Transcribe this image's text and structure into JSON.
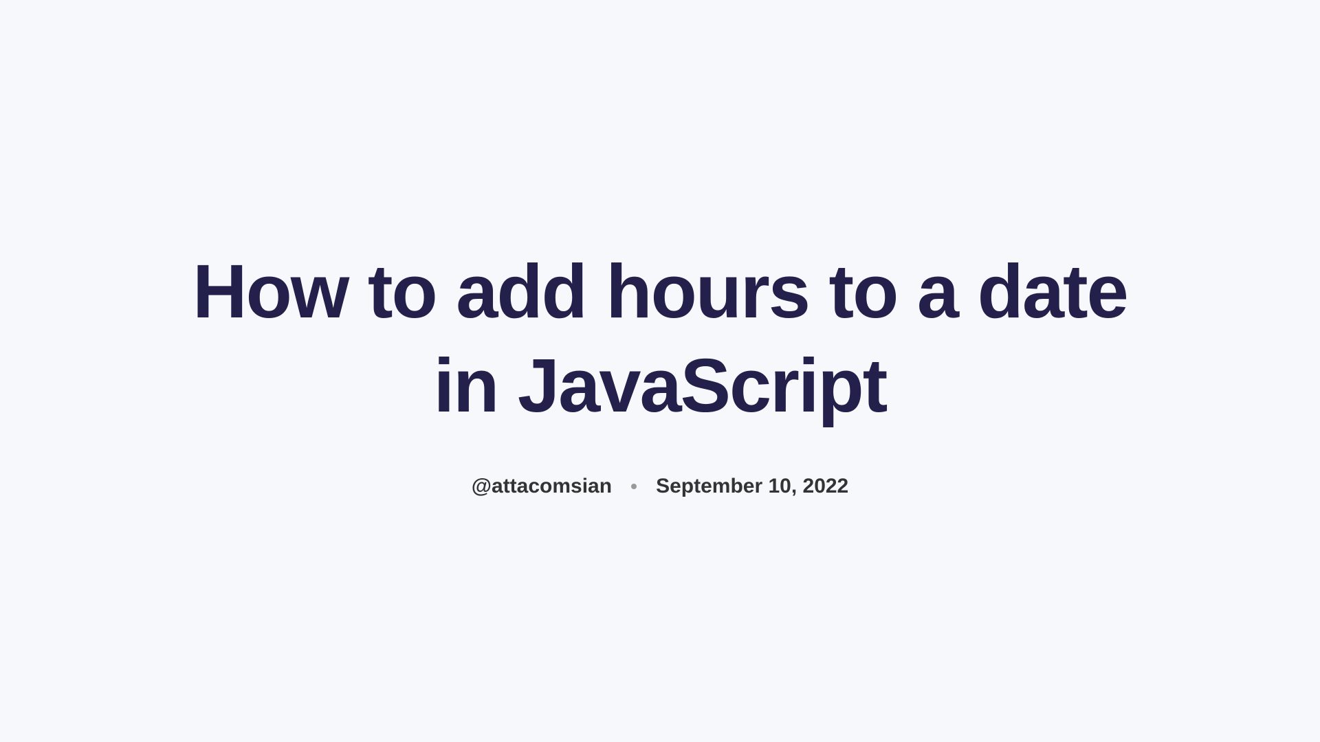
{
  "article": {
    "title": "How to add hours to a date in JavaScript",
    "author": "@attacomsian",
    "date": "September 10, 2022"
  }
}
